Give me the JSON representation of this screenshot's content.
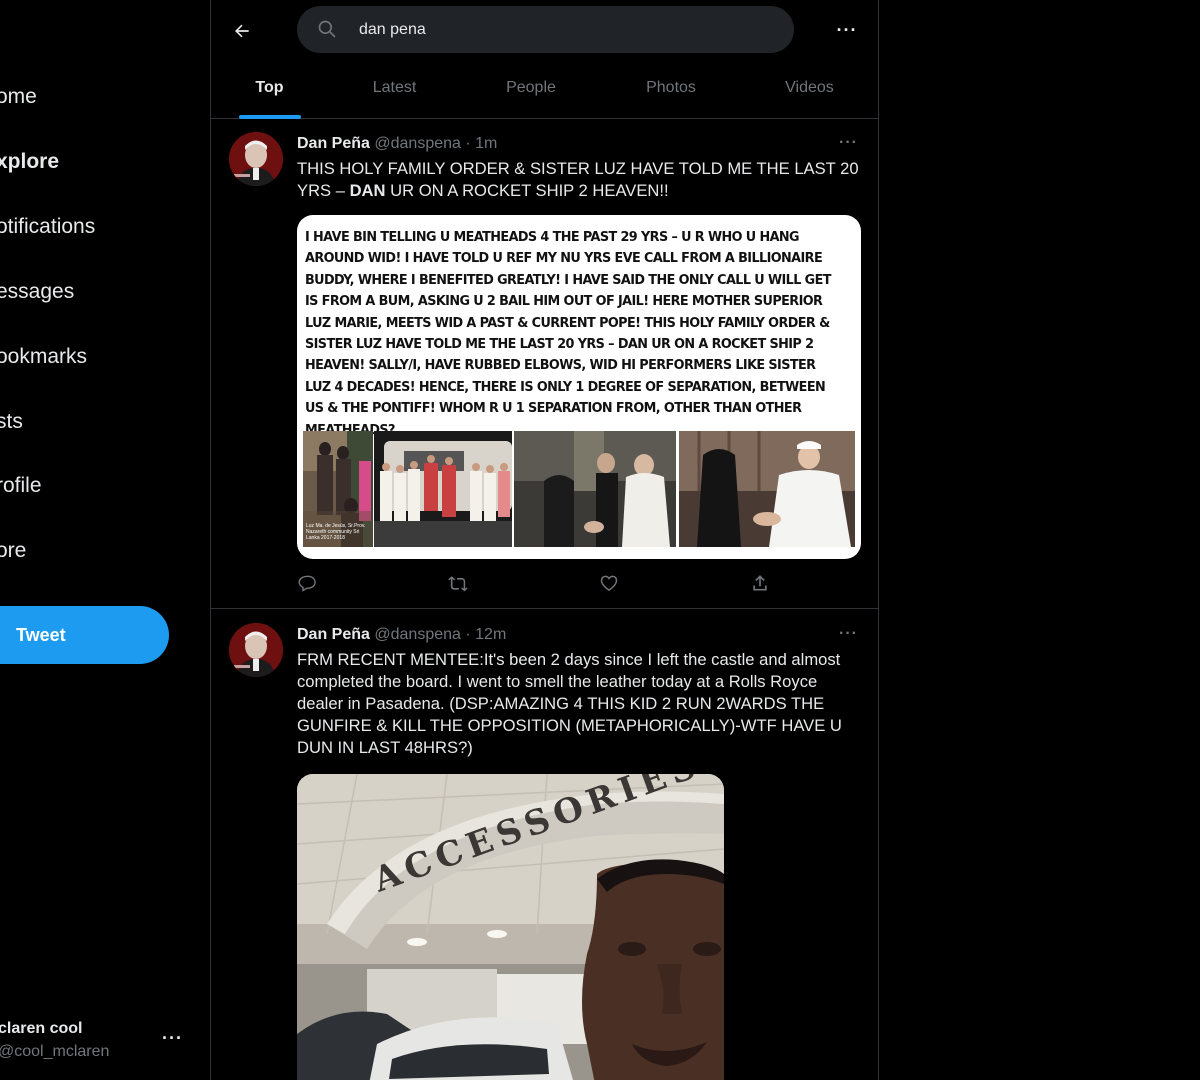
{
  "sidebar": {
    "items": [
      {
        "label": "ome",
        "name": "home"
      },
      {
        "label": "xplore",
        "name": "explore"
      },
      {
        "label": "otifications",
        "name": "notifications"
      },
      {
        "label": "essages",
        "name": "messages"
      },
      {
        "label": "ookmarks",
        "name": "bookmarks"
      },
      {
        "label": "sts",
        "name": "lists"
      },
      {
        "label": "rofile",
        "name": "profile"
      },
      {
        "label": "ore",
        "name": "more"
      }
    ],
    "tweet_button": "Tweet",
    "account": {
      "name": "claren cool",
      "handle": "@cool_mclaren",
      "more": "···"
    }
  },
  "header": {
    "search": {
      "value": "dan pena"
    },
    "more": "···",
    "tabs": [
      "Top",
      "Latest",
      "People",
      "Photos",
      "Videos"
    ],
    "active_tab": "Top"
  },
  "tweets": [
    {
      "name": "Dan Peña",
      "handle": "@danspena",
      "dot": "·",
      "time": "1m",
      "more": "···",
      "text_before": "THIS HOLY FAMILY ORDER & SISTER LUZ HAVE TOLD ME THE LAST 20 YRS – ",
      "text_bold": "DAN",
      "text_after": " UR ON A ROCKET SHIP 2 HEAVEN!!",
      "media_caption": "I HAVE BIN TELLING U MEATHEADS 4 THE PAST 29 YRS – U R WHO U HANG AROUND WID! I HAVE TOLD U REF MY NU YRS EVE CALL FROM A BILLIONAIRE BUDDY, WHERE I BENEFITED GREATLY! I HAVE SAID THE ONLY CALL U WILL GET IS FROM A BUM, ASKING U 2 BAIL HIM OUT OF JAIL! HERE MOTHER SUPERIOR LUZ MARIE, MEETS WID A PAST & CURRENT POPE! THIS HOLY FAMILY ORDER & SISTER LUZ HAVE TOLD ME THE LAST 20 YRS – DAN UR ON A ROCKET SHIP 2 HEAVEN! SALLY/I, HAVE RUBBED ELBOWS, WID HI PERFORMERS LIKE SISTER LUZ 4 DECADES! HENCE, THERE IS ONLY 1 DEGREE OF SEPARATION, BETWEEN US & THE PONTIFF! WHOM R U 1 SEPARATION FROM, OTHER THAN OTHER MEATHEADS?",
      "photo_tiny_text": "Luz Ma. de Jesús, Sr.Prov. Nazareth community Sri Lanka 2017-2018"
    },
    {
      "name": "Dan Peña",
      "handle": "@danspena",
      "dot": "·",
      "time": "12m",
      "more": "···",
      "text": "FRM RECENT MENTEE:It's been 2 days since I left the castle and almost completed the board. I went to smell the leather today at a Rolls Royce dealer in Pasadena. (DSP:AMAZING 4 THIS KID 2 RUN 2WARDS THE GUNFIRE & KILL THE OPPOSITION (METAPHORICALLY)-WTF HAVE U DUN IN LAST 48HRS?)",
      "photo_sign": "ACCESSORIES"
    }
  ],
  "colors": {
    "accent": "#1d9bf0",
    "background": "#000000",
    "muted": "#71767b",
    "border": "#2f3336"
  }
}
